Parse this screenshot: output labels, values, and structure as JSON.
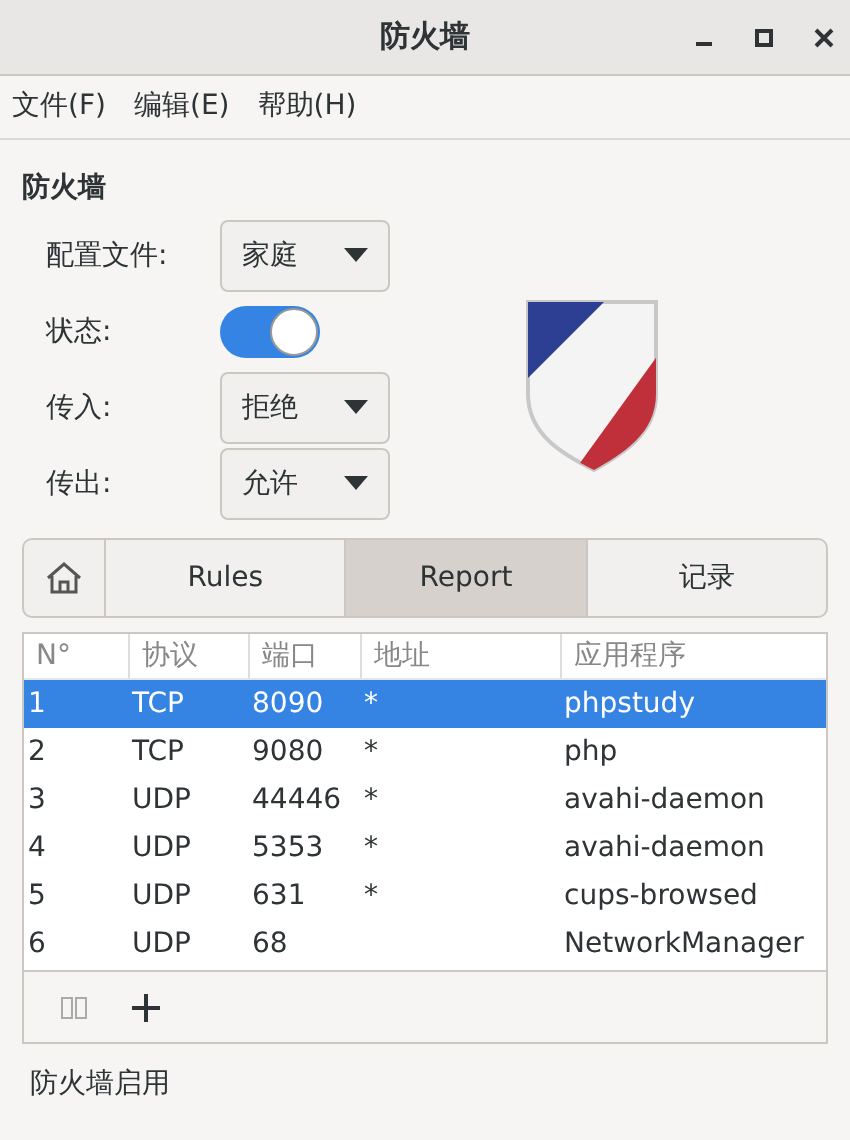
{
  "window": {
    "title": "防火墙"
  },
  "menu": [
    {
      "label": "文件(F)"
    },
    {
      "label": "编辑(E)"
    },
    {
      "label": "帮助(H)"
    }
  ],
  "heading": "防火墙",
  "settings": [
    {
      "kind": "dropdown",
      "label": "配置文件:",
      "value": "家庭"
    },
    {
      "kind": "switch",
      "label": "状态:",
      "on": true
    },
    {
      "kind": "dropdown",
      "label": "传入:",
      "value": "拒绝"
    },
    {
      "kind": "dropdown",
      "label": "传出:",
      "value": "允许"
    }
  ],
  "tabs": [
    {
      "label": "Rules",
      "selected": false
    },
    {
      "label": "Report",
      "selected": true
    },
    {
      "label": "记录",
      "selected": false
    }
  ],
  "table": {
    "columns": [
      "N°",
      "协议",
      "端口",
      "地址",
      "应用程序"
    ],
    "rows": [
      {
        "cells": [
          "1",
          "TCP",
          "8090",
          "*",
          "phpstudy"
        ],
        "selected": true
      },
      {
        "cells": [
          "2",
          "TCP",
          "9080",
          "*",
          "php"
        ],
        "selected": false
      },
      {
        "cells": [
          "3",
          "UDP",
          "44446",
          "*",
          "avahi-daemon"
        ],
        "selected": false
      },
      {
        "cells": [
          "4",
          "UDP",
          "5353",
          "*",
          "avahi-daemon"
        ],
        "selected": false
      },
      {
        "cells": [
          "5",
          "UDP",
          "631",
          "*",
          "cups-browsed"
        ],
        "selected": false
      },
      {
        "cells": [
          "6",
          "UDP",
          "68",
          "",
          "NetworkManager"
        ],
        "selected": false
      }
    ]
  },
  "status_bar": "防火墙启用"
}
